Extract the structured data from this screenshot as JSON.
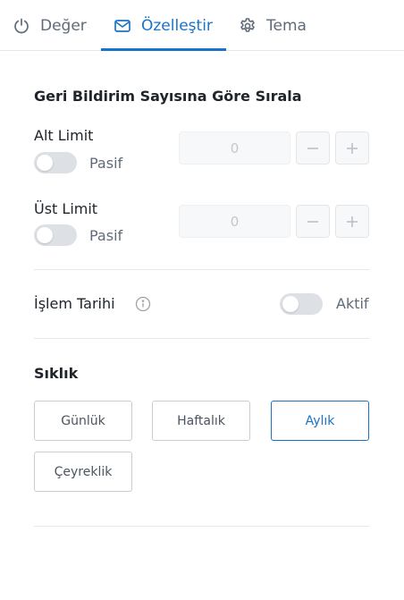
{
  "tabs": [
    {
      "label": "Değer",
      "icon": "power-icon",
      "active": false
    },
    {
      "label": "Özelleştir",
      "icon": "mail-icon",
      "active": true
    },
    {
      "label": "Tema",
      "icon": "gear-icon",
      "active": false
    }
  ],
  "sort_section": {
    "title": "Geri Bildirim Sayısına Göre Sırala",
    "lower": {
      "label": "Alt Limit",
      "toggle_text": "Pasif",
      "value": "",
      "placeholder": "0"
    },
    "upper": {
      "label": "Üst Limit",
      "toggle_text": "Pasif",
      "value": "",
      "placeholder": "0"
    }
  },
  "transaction_date": {
    "label": "İşlem Tarihi",
    "toggle_text": "Aktif"
  },
  "frequency": {
    "title": "Sıklık",
    "options": [
      "Günlük",
      "Haftalık",
      "Aylık",
      "Çeyreklik"
    ],
    "selected": "Aylık"
  },
  "colors": {
    "accent": "#1a73c9",
    "toggle_off": "#dde0e5",
    "muted_text": "#5f6b78"
  }
}
